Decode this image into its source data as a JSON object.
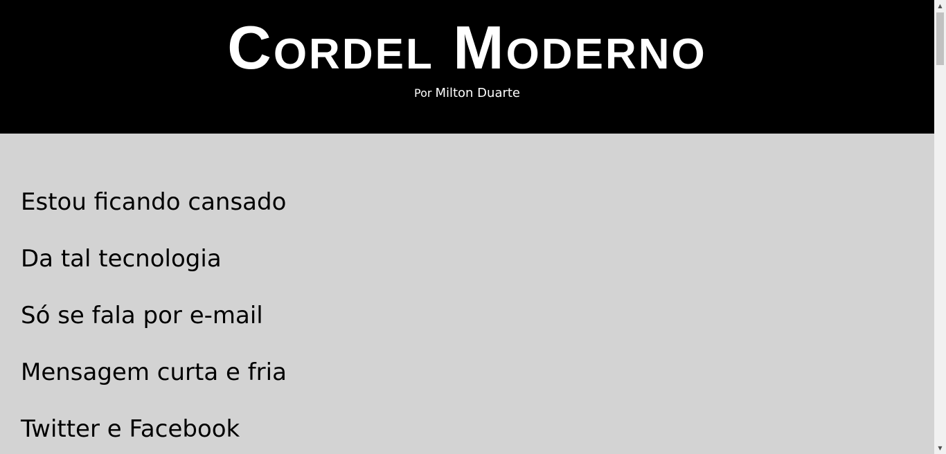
{
  "header": {
    "title": "Cordel Moderno",
    "by_prefix": "Por",
    "author": "Milton Duarte"
  },
  "poem": {
    "verses": [
      "Estou ficando cansado",
      "Da tal tecnologia",
      "Só se fala por e-mail",
      "Mensagem curta e fria",
      "Twitter e Facebook"
    ]
  },
  "scrollbar": {
    "up_icon": "▲",
    "down_icon": "▼"
  },
  "colors": {
    "header_background": "#000000",
    "header_text": "#ffffff",
    "page_background": "#d3d3d3",
    "verse_text": "#000000"
  }
}
